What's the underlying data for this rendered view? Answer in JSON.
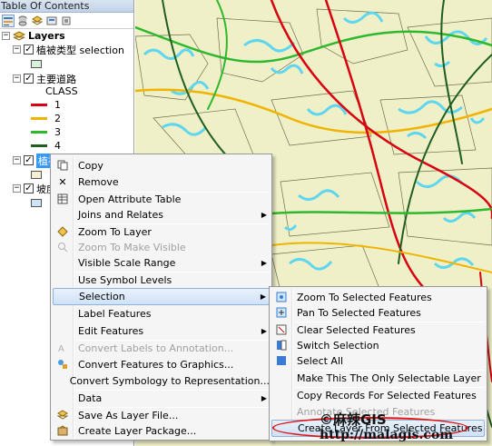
{
  "toc": {
    "title": "Table Of Contents",
    "toolbar_icons": [
      "list-by-drawing-order-icon",
      "list-by-source-icon",
      "list-by-visibility-icon",
      "list-by-selection-icon",
      "options-icon"
    ],
    "root_label": "Layers",
    "layers": [
      {
        "label": "植被类型 selection",
        "checked": true,
        "swatch_color": "#d8f0dc"
      },
      {
        "label": "主要道路",
        "checked": true,
        "class_header": "CLASS",
        "classes": [
          {
            "value": "1",
            "color": "#d9000f"
          },
          {
            "value": "2",
            "color": "#f0b400"
          },
          {
            "value": "3",
            "color": "#2db82d"
          },
          {
            "value": "4",
            "color": "#1f5e1f"
          }
        ]
      },
      {
        "label": "植被",
        "checked": true,
        "selected": true,
        "swatch_color": "#f2efd2"
      },
      {
        "label": "坡度",
        "checked": true,
        "swatch_color": "#cce4f4"
      }
    ]
  },
  "context_menu": {
    "items": [
      {
        "label": "Copy",
        "icon": "copy-icon"
      },
      {
        "label": "Remove",
        "icon": "remove-icon"
      },
      {
        "label": "Open Attribute Table",
        "icon": "table-icon"
      },
      {
        "label": "Joins and Relates",
        "submenu": true
      },
      {
        "label": "Zoom To Layer",
        "icon": "zoom-to-layer-icon"
      },
      {
        "label": "Zoom To Make Visible",
        "disabled": true,
        "icon": "zoom-visible-icon"
      },
      {
        "label": "Visible Scale Range",
        "submenu": true
      },
      {
        "label": "Use Symbol Levels"
      },
      {
        "label": "Selection",
        "submenu": true,
        "highlighted": true
      },
      {
        "label": "Label Features"
      },
      {
        "label": "Edit Features",
        "submenu": true
      },
      {
        "label": "Convert Labels to Annotation...",
        "disabled": true,
        "icon": "convert-labels-icon"
      },
      {
        "label": "Convert Features to Graphics...",
        "icon": "convert-graphics-icon"
      },
      {
        "label": "Convert Symbology to Representation..."
      },
      {
        "label": "Data",
        "submenu": true
      },
      {
        "label": "Save As Layer File...",
        "icon": "save-layer-icon"
      },
      {
        "label": "Create Layer Package...",
        "icon": "layer-package-icon"
      }
    ]
  },
  "selection_submenu": {
    "items": [
      {
        "label": "Zoom To Selected Features",
        "icon": "zoom-selected-icon"
      },
      {
        "label": "Pan To Selected Features",
        "icon": "pan-selected-icon"
      },
      {
        "label": "Clear Selected Features",
        "icon": "clear-selection-icon"
      },
      {
        "label": "Switch Selection",
        "icon": "switch-selection-icon"
      },
      {
        "label": "Select All",
        "icon": "select-all-icon"
      },
      {
        "label": "Make This The Only Selectable Layer"
      },
      {
        "label": "Copy Records For Selected Features"
      },
      {
        "label": "Annotate Selected Features",
        "disabled": true
      },
      {
        "label": "Create Layer From Selected Features",
        "highlighted": true
      }
    ]
  },
  "watermark": {
    "line1": "©麻辣GIS",
    "line2": "http://malagis.com"
  },
  "colors": {
    "map_background": "#eff0c8",
    "selection_cyan": "#5fd6ef",
    "road_red": "#d9000f",
    "road_orange": "#f0b400",
    "road_green": "#2db82d",
    "road_dark": "#1f5e1f",
    "ellipse": "#e01515"
  }
}
